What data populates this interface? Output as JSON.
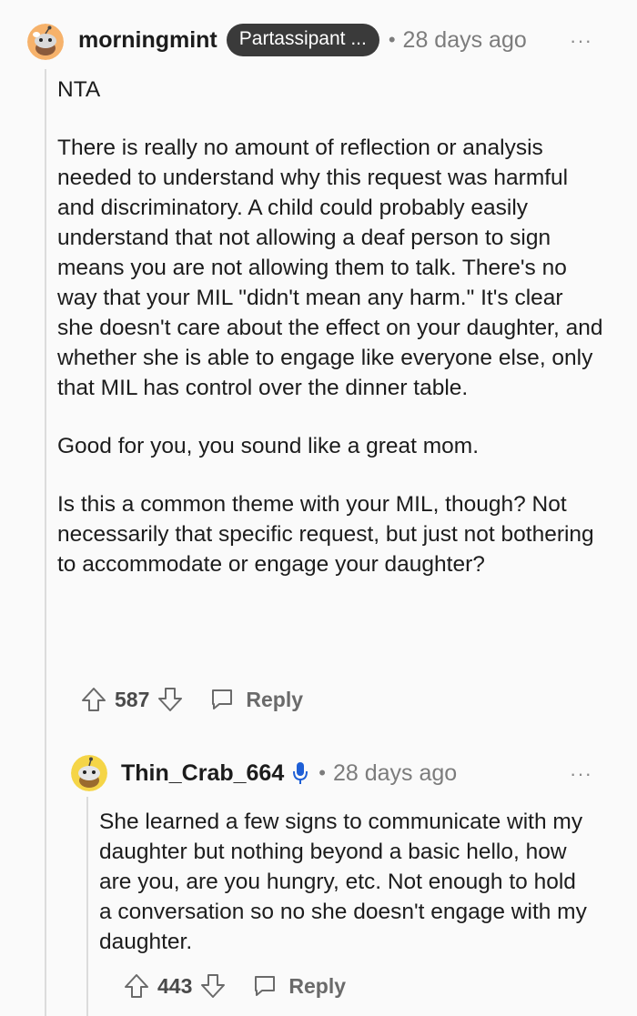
{
  "comment": {
    "username": "morningmint",
    "flair": "Partassipant ...",
    "separator": "•",
    "time": "28 days ago",
    "more": "···",
    "paragraphs": [
      "NTA",
      "There is really no amount of reflection or analysis needed to understand why this request was harmful and discriminatory. A child could probably easily understand that not allowing a deaf person to sign means you are not allowing them to talk. There's no way that your MIL \"didn't mean any harm.\" It's clear she doesn't care about the effect on your daughter, and whether she is able to engage like everyone else, only that MIL has control over the dinner table.",
      "Good for you, you sound like a great mom.",
      "Is this a common theme with your MIL, though? Not necessarily that specific request, but just not bothering to accommodate or engage your daughter?"
    ],
    "votes": "587",
    "reply_label": "Reply"
  },
  "reply": {
    "username": "Thin_Crab_664",
    "separator": "•",
    "time": "28 days ago",
    "more": "···",
    "paragraphs": [
      "She learned a few signs to communicate with my daughter but nothing beyond a basic hello, how are you, are you hungry, etc. Not enough to hold a conversation so no she doesn't engage with my daughter."
    ],
    "votes": "443",
    "reply_label": "Reply"
  },
  "colors": {
    "background": "#fafafa",
    "flair_bg": "#3a3a3a",
    "mic_icon": "#1e5fd6",
    "avatar_1": "#f6b26b",
    "avatar_2": "#f5d547"
  }
}
